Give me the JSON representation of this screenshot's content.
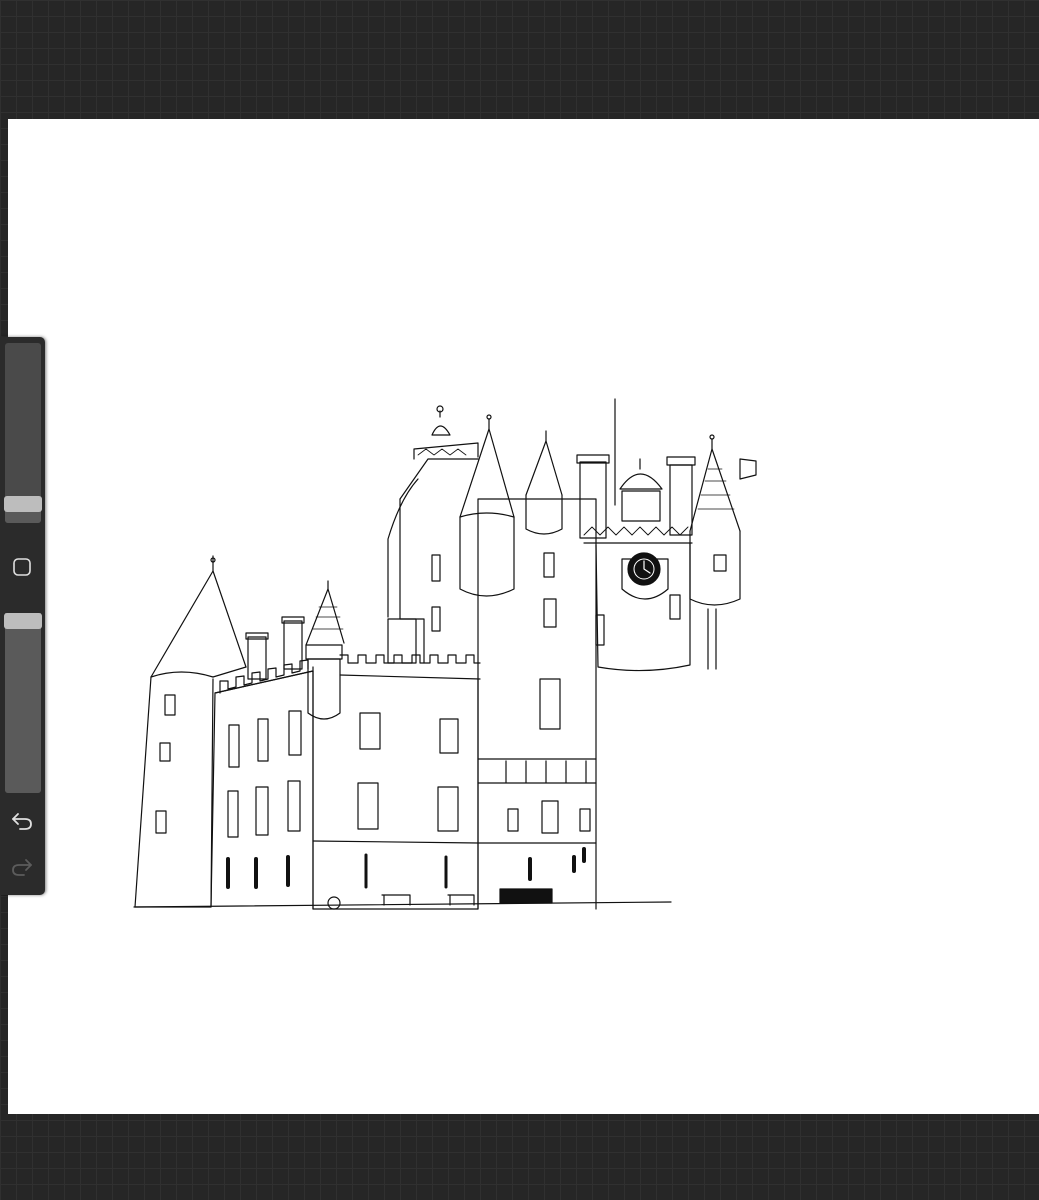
{
  "app": {
    "canvas_background": "#ffffff",
    "workspace_background": "#262626",
    "accent_color": "#bdbdbd"
  },
  "sidebar": {
    "brush_size": {
      "value": 0.14,
      "icon": "slider-thumb"
    },
    "modify_button": {
      "icon": "square-outline-icon"
    },
    "brush_opacity": {
      "value": 1.0,
      "icon": "slider-thumb"
    },
    "undo_button": {
      "icon": "undo-arrow-icon",
      "enabled": true
    },
    "redo_button": {
      "icon": "redo-arrow-icon",
      "enabled": false
    }
  },
  "artwork": {
    "subject": "castle-line-drawing"
  }
}
